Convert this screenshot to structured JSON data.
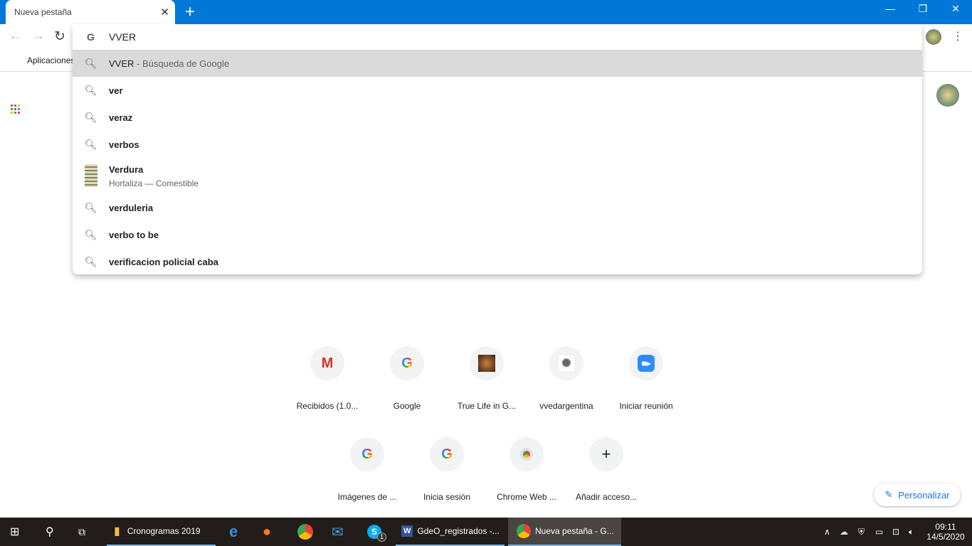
{
  "browser": {
    "tab_title": "Nueva pestaña",
    "bookmarks": {
      "apps_label": "Aplicaciones"
    }
  },
  "omnibox": {
    "value": "VVER",
    "suggestions": [
      {
        "text": "VVER",
        "suffix": " - Búsqueda de Google",
        "icon": "search-icon",
        "highlighted": true
      },
      {
        "text": "ver",
        "icon": "search-icon"
      },
      {
        "text": "veraz",
        "icon": "search-icon"
      },
      {
        "text": "verbos",
        "icon": "search-icon"
      },
      {
        "text": "Verdura",
        "subtitle": "Hortaliza — Comestible",
        "icon": "image-thumbnail"
      },
      {
        "text": "verduleria",
        "icon": "search-icon"
      },
      {
        "text": "verbo to be",
        "icon": "search-icon"
      },
      {
        "text": "verificacion policial caba",
        "icon": "search-icon"
      }
    ]
  },
  "shortcuts": [
    {
      "label": "Recibidos (1.0...",
      "icon": "gmail-icon"
    },
    {
      "label": "Google",
      "icon": "google-icon"
    },
    {
      "label": "True Life in G...",
      "icon": "portrait-icon"
    },
    {
      "label": "vvedargentina",
      "icon": "seal-icon"
    },
    {
      "label": "Iniciar reunión",
      "icon": "zoom-icon"
    },
    {
      "label": "Imágenes de ...",
      "icon": "google-icon"
    },
    {
      "label": "Inicia sesión",
      "icon": "google-icon"
    },
    {
      "label": "Chrome Web ...",
      "icon": "chrome-web-store-icon"
    },
    {
      "label": "Añadir acceso...",
      "icon": "plus-icon"
    }
  ],
  "customize_label": "Personalizar",
  "taskbar": {
    "items": [
      "Cronogramas 2019",
      "GdeO_registrados -...",
      "Nueva pestaña - G..."
    ],
    "skype_badge": "1",
    "time": "09:11",
    "date": "14/5/2020"
  },
  "colors": {
    "accent": "#0078d7",
    "highlight": "#dadada"
  }
}
